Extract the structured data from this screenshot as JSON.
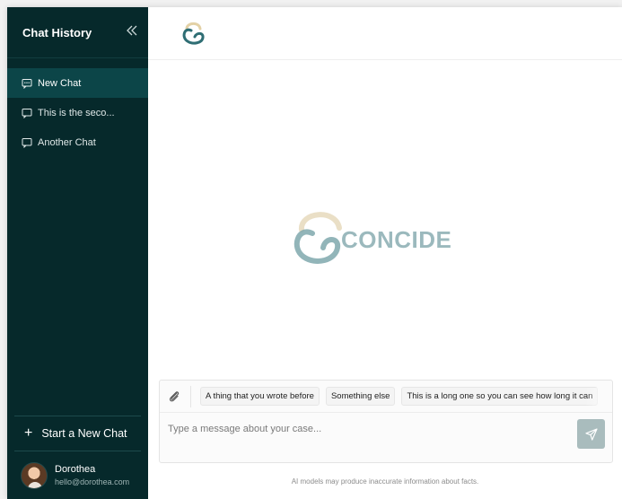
{
  "sidebar": {
    "title": "Chat History",
    "collapse_icon": "double-chevron-left-icon",
    "chats": [
      {
        "label": "New Chat",
        "active": true
      },
      {
        "label": "This is the seco...",
        "active": false
      },
      {
        "label": "Another Chat",
        "active": false
      }
    ],
    "new_chat_label": "Start a New Chat",
    "user": {
      "name": "Dorothea",
      "email": "hello@dorothea.com"
    }
  },
  "brand": {
    "name": "CONCIDE",
    "colors": {
      "teal": "#4d8d93",
      "gold": "#e3d1a6",
      "text": "#9bb9bd"
    }
  },
  "composer": {
    "suggestions": [
      "A thing that you wrote before",
      "Something else",
      "This is a long one so you can see how long it can"
    ],
    "placeholder": "Type a message about your case..."
  },
  "disclaimer": "AI models may produce inaccurate information about facts.",
  "colors": {
    "sidebar_bg": "#06292b",
    "sidebar_active": "#0c4548",
    "send_button": "#a9bcbd"
  }
}
